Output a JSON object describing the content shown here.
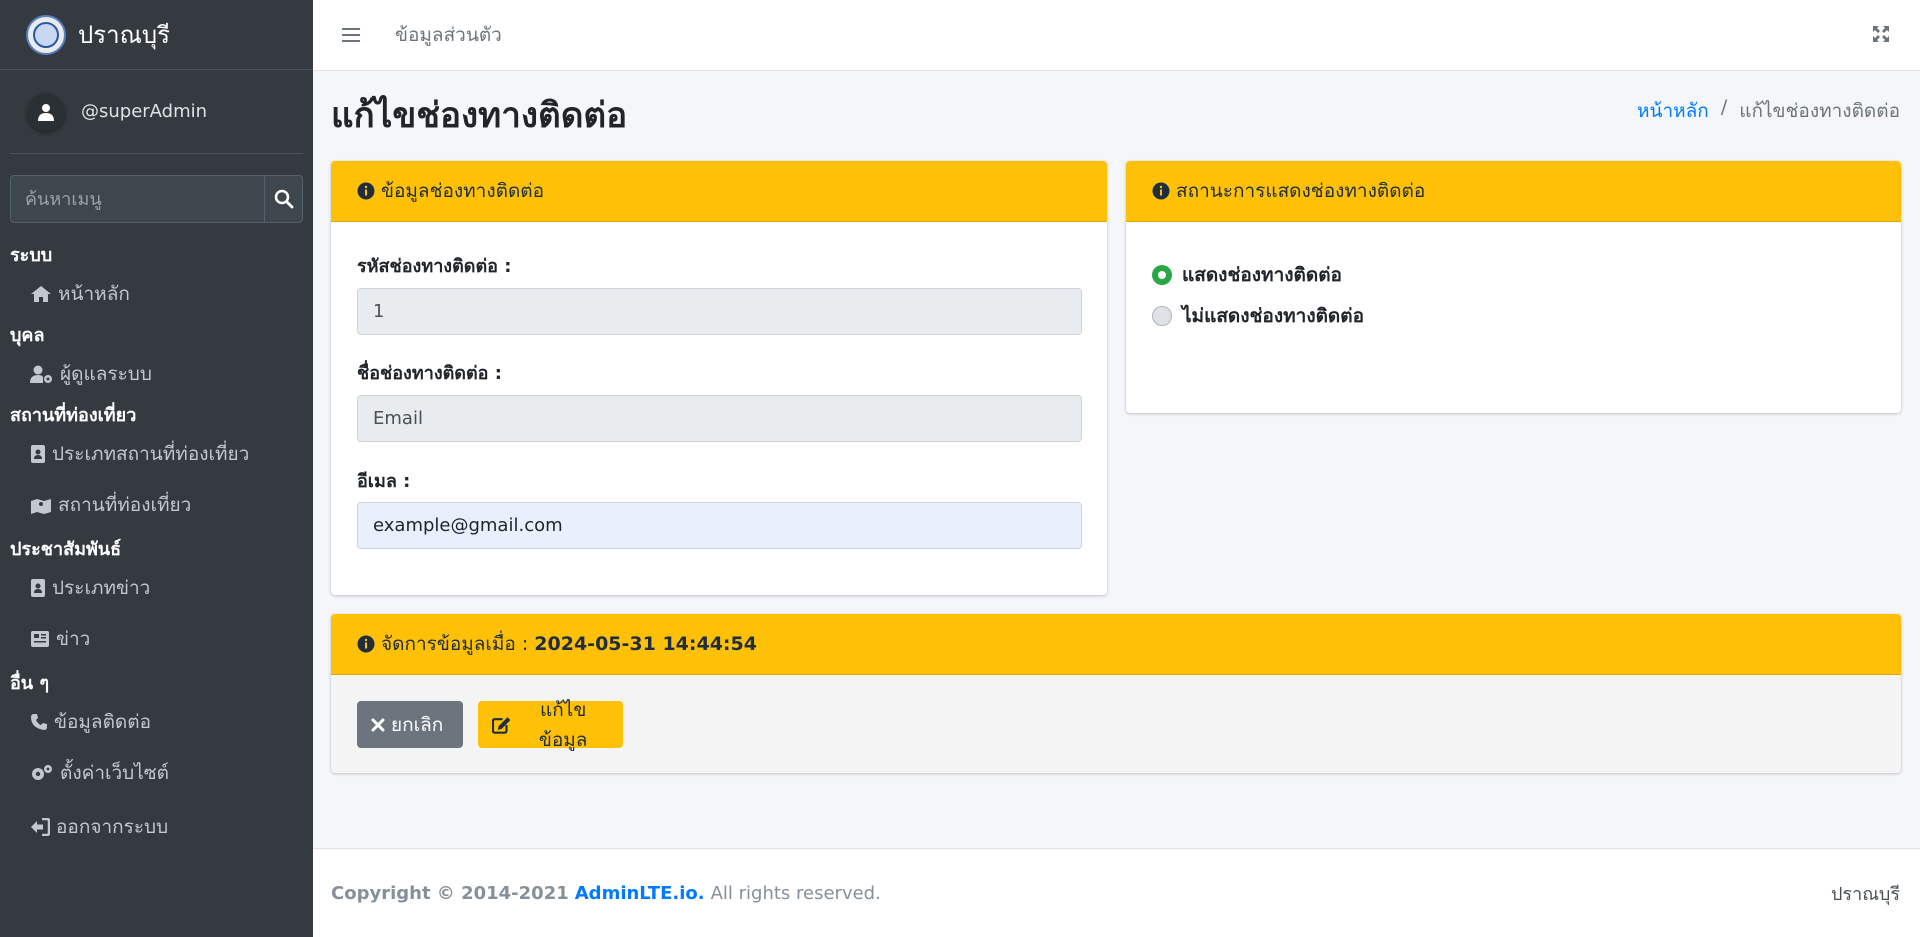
{
  "brand": {
    "name": "ปราณบุรี"
  },
  "user": {
    "name": "@superAdmin"
  },
  "search": {
    "placeholder": "ค้นหาเมนู"
  },
  "nav": {
    "sections": [
      {
        "header": "ระบบ",
        "items": [
          {
            "label": "หน้าหลัก",
            "icon": "home-icon"
          }
        ]
      },
      {
        "header": "บุคล",
        "items": [
          {
            "label": "ผู้ดูแลระบบ",
            "icon": "user-cog-icon"
          }
        ]
      },
      {
        "header": "สถานที่ท่องเที่ยว",
        "items": [
          {
            "label": "ประเภทสถานที่ท่องเที่ยว",
            "icon": "address-book-icon"
          },
          {
            "label": "สถานที่ท่องเที่ยว",
            "icon": "map-marked-icon"
          }
        ]
      },
      {
        "header": "ประชาสัมพันธ์",
        "items": [
          {
            "label": "ประเภทข่าว",
            "icon": "address-book-icon"
          },
          {
            "label": "ข่าว",
            "icon": "newspaper-icon"
          }
        ]
      },
      {
        "header": "อื่น ๆ",
        "items": [
          {
            "label": "ข้อมูลติดต่อ",
            "icon": "phone-icon"
          },
          {
            "label": "ตั้งค่าเว็บไซต์",
            "icon": "cogs-icon"
          },
          {
            "label": "ออกจากระบบ",
            "icon": "sign-out-icon"
          }
        ]
      }
    ]
  },
  "topbar": {
    "link": "ข้อมูลส่วนตัว"
  },
  "page": {
    "title": "แก้ไขช่องทางติดต่อ"
  },
  "breadcrumb": {
    "home": "หน้าหลัก",
    "separator": "/",
    "current": "แก้ไขช่องทางติดต่อ"
  },
  "card_info": {
    "title": "ข้อมูลช่องทางติดต่อ",
    "fields": [
      {
        "label": "รหัสช่องทางติดต่อ :",
        "value": "1"
      },
      {
        "label": "ชื่อช่องทางติดต่อ :",
        "value": "Email"
      },
      {
        "label": "อีเมล :",
        "value": "example@gmail.com"
      }
    ]
  },
  "card_status": {
    "title": "สถานะการแสดงช่องทางติดต่อ",
    "options": [
      {
        "label": "แสดงช่องทางติดต่อ",
        "selected": true
      },
      {
        "label": "ไม่แสดงช่องทางติดต่อ",
        "selected": false
      }
    ]
  },
  "card_manage": {
    "title_prefix": "จัดการข้อมูลเมื่อ :",
    "timestamp": "2024-05-31 14:44:54",
    "cancel_label": "ยกเลิก",
    "edit_label": "แก้ไขข้อมูล"
  },
  "footer": {
    "copyright": "Copyright © 2014-2021",
    "brand_link": "AdminLTE.io.",
    "rest": "All rights reserved.",
    "right": "ปราณบุรี"
  },
  "colors": {
    "accent": "#ffc107",
    "sidebar": "#343a40",
    "success": "#28a745",
    "link": "#007bff"
  }
}
